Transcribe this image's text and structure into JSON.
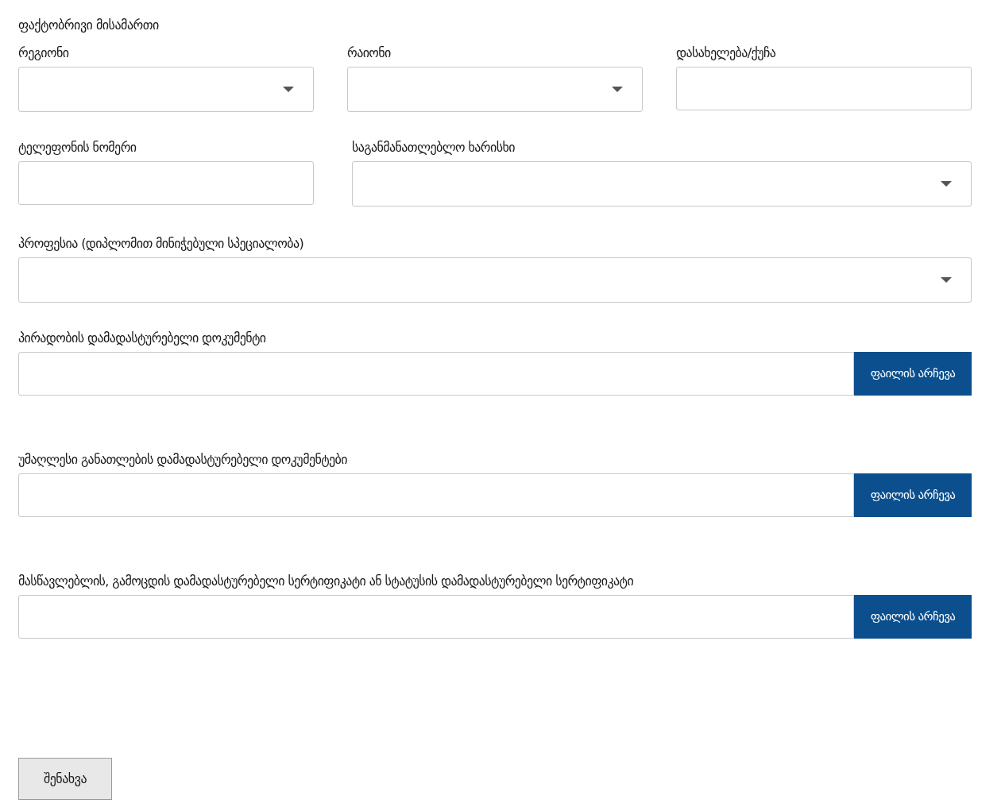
{
  "title": "ფაქტობრივი მისამართი",
  "rows": [
    [
      {
        "kind": "select",
        "label": "რეგიონი"
      },
      {
        "kind": "select",
        "label": "რაიონი"
      },
      {
        "kind": "text",
        "label": "დასახელება/ქუჩა"
      }
    ],
    [
      {
        "kind": "text",
        "label": "ტელეფონის ნომერი"
      },
      {
        "kind": "select",
        "label": "საგანმანათლებლო ხარისხი"
      }
    ],
    [
      {
        "kind": "select",
        "label": "პროფესია (დიპლომით მინიჭებული სპეციალობა)"
      }
    ],
    [
      {
        "kind": "file",
        "label": "პირადობის დამადასტურებელი დოკუმენტი",
        "button": "ფაილის არჩევა"
      }
    ],
    [
      {
        "kind": "file",
        "label": "უმაღლესი განათლების დამადასტურებელი დოკუმენტები",
        "button": "ფაილის არჩევა"
      }
    ],
    [
      {
        "kind": "file",
        "label": "მასწავლებლის, გამოცდის დამადასტურებელი სერტიფიკატი ან სტატუსის დამადასტურებელი სერტიფიკატი",
        "button": "ფაილის არჩევა"
      }
    ]
  ],
  "submit": "შენახვა"
}
